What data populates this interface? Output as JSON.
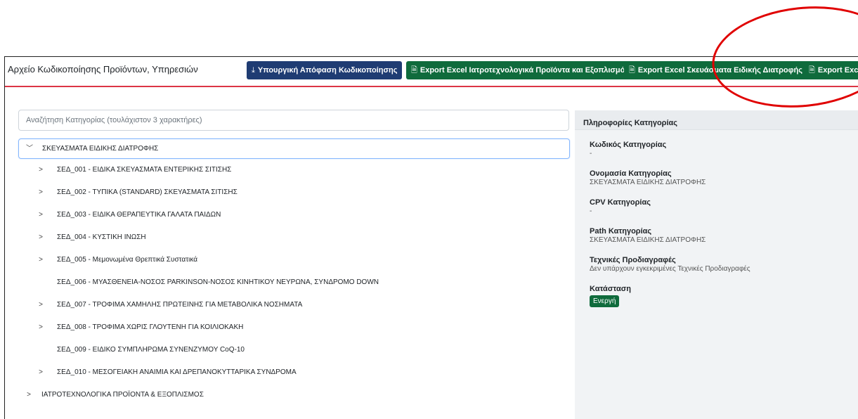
{
  "header": {
    "title": "Αρχείο Κωδικοποίησης Προϊόντων, Υπηρεσιών",
    "buttons": [
      {
        "label": "Υπουργική Απόφαση Κωδικοποίησης",
        "icon": "download-icon"
      },
      {
        "label": "Export Excel Ιατροτεχνολογικά Προϊόντα και Εξοπλισμός",
        "icon": "excel-icon"
      },
      {
        "label": "Export Excel Σκευάσματα Ειδικής Διατροφής",
        "icon": "excel-icon"
      },
      {
        "label": "Export Exc",
        "icon": "excel-icon"
      }
    ]
  },
  "search": {
    "placeholder": "Αναζήτηση Κατηγορίας (τουλάχιστον 3 χαρακτήρες)"
  },
  "tree": {
    "root": "ΣΚΕΥΑΣΜΑΤΑ ΕΙΔΙΚΗΣ ΔΙΑΤΡΟΦΗΣ",
    "children": [
      {
        "label": "ΣΕΔ_001 - ΕΙΔΙΚΑ ΣΚΕΥΑΣΜΑΤΑ ΕΝΤΕΡΙΚΗΣ ΣΙΤΙΣΗΣ",
        "expandable": true
      },
      {
        "label": "ΣΕΔ_002 - ΤΥΠΙΚΑ (STANDARD) ΣΚΕΥΑΣΜΑΤΑ ΣΙΤΙΣΗΣ",
        "expandable": true
      },
      {
        "label": "ΣΕΔ_003 - ΕΙΔΙΚΑ ΘΕΡΑΠΕΥΤΙΚΑ ΓΑΛΑΤΑ ΠΑΙΔΩΝ",
        "expandable": true
      },
      {
        "label": "ΣΕΔ_004 - ΚΥΣΤΙΚΗ ΙΝΩΣΗ",
        "expandable": true
      },
      {
        "label": "ΣΕΔ_005 - Μεμονωμένα Θρεπτικά Συστατικά",
        "expandable": true
      },
      {
        "label": "ΣΕΔ_006 - ΜΥΑΣΘΕΝΕΙΑ-ΝΟΣΟΣ PARKINSON-ΝΟΣΟΣ ΚΙΝΗΤΙΚΟΥ ΝΕΥΡΩΝΑ, ΣΥΝΔΡΟΜΟ DOWN",
        "expandable": false
      },
      {
        "label": "ΣΕΔ_007 - ΤΡΟΦΙΜΑ ΧΑΜΗΛΗΣ ΠΡΩΤΕΙΝΗΣ ΓΙΑ ΜΕΤΑΒΟΛΙΚΑ ΝΟΣΗΜΑΤΑ",
        "expandable": true
      },
      {
        "label": "ΣΕΔ_008 - ΤΡΟΦΙΜΑ ΧΩΡΙΣ ΓΛΟΥΤΕΝΗ ΓΙΑ ΚΟΙΛΙΟΚΑΚΗ",
        "expandable": true
      },
      {
        "label": "ΣΕΔ_009 - ΕΙΔΙΚΟ ΣΥΜΠΛΗΡΩΜΑ ΣΥΝΕΝΖΥΜΟΥ CoQ-10",
        "expandable": false
      },
      {
        "label": "ΣΕΔ_010 - ΜΕΣΟΓΕΙΑΚΗ ΑΝΑΙΜΙΑ ΚΑΙ ΔΡΕΠΑΝΟΚΥΤΤΑΡΙΚΑ ΣΥΝΔΡΟΜΑ",
        "expandable": true
      }
    ],
    "root2": "ΙΑΤΡΟΤΕΧΝΟΛΟΓΙΚΑ ΠΡΟΪΟΝΤΑ & ΕΞΟΠΛΙΣΜΟΣ"
  },
  "panel": {
    "title": "Πληροφορίες Κατηγορίας",
    "fields": [
      {
        "key": "Κωδικός Κατηγορίας",
        "value": "-"
      },
      {
        "key": "Ονομασία Κατηγορίας",
        "value": "ΣΚΕΥΑΣΜΑΤΑ ΕΙΔΙΚΗΣ ΔΙΑΤΡΟΦΗΣ"
      },
      {
        "key": "CPV Κατηγορίας",
        "value": "-"
      },
      {
        "key": "Path Κατηγορίας",
        "value": "ΣΚΕΥΑΣΜΑΤΑ ΕΙΔΙΚΗΣ ΔΙΑΤΡΟΦΗΣ"
      },
      {
        "key": "Τεχνικές Προδιαγραφές",
        "value": "Δεν υπάρχουν εγκεκριμένες Τεχνικές Προδιαγραφές"
      }
    ],
    "status_label": "Κατάσταση",
    "status_value": "Ενεργή"
  },
  "colors": {
    "primary": "#1f3c73",
    "success": "#0f6b3c",
    "header_rule": "#dc3545",
    "annotation": "#e00000"
  }
}
